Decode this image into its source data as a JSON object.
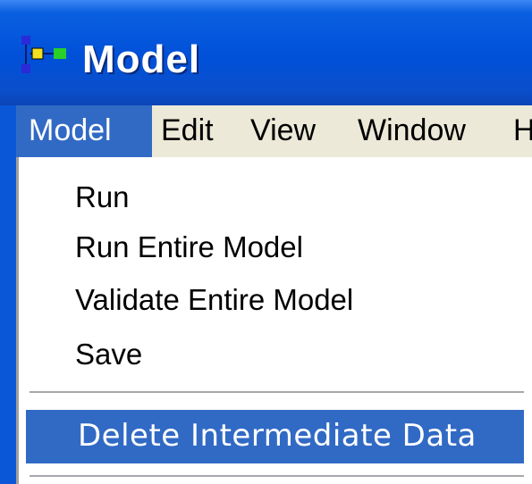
{
  "window": {
    "title": "Model",
    "icon": "model-app-icon"
  },
  "menubar": {
    "items": [
      {
        "label": "Model",
        "active": true
      },
      {
        "label": "Edit"
      },
      {
        "label": "View"
      },
      {
        "label": "Window"
      },
      {
        "label": "H"
      }
    ]
  },
  "dropdown": {
    "items": [
      {
        "label": "Run"
      },
      {
        "label": "Run Entire Model"
      },
      {
        "label": "Validate Entire Model"
      },
      {
        "label": "Save"
      }
    ],
    "highlighted": {
      "label": "Delete Intermediate Data"
    }
  },
  "colors": {
    "title_bar": "#0050d8",
    "menu_bar": "#ece9d8",
    "selection": "#316ac5"
  }
}
